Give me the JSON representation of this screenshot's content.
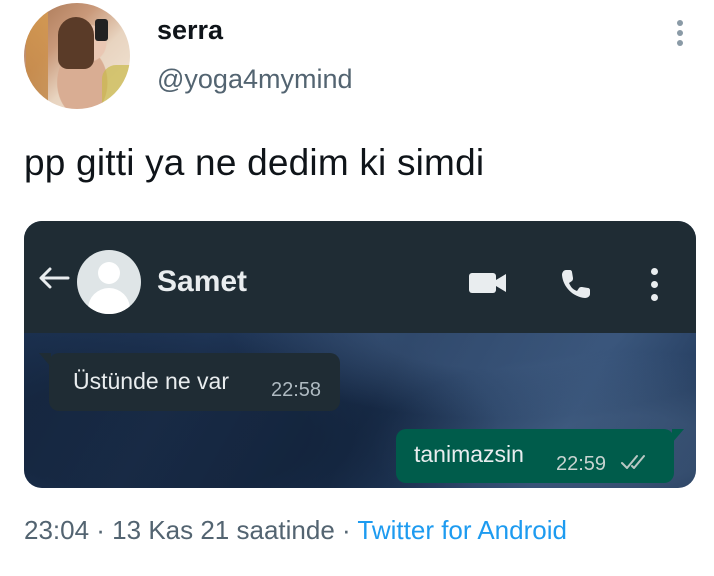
{
  "author": {
    "display_name": "serra",
    "handle": "@yoga4mymind"
  },
  "tweet": {
    "text": "pp gitti ya ne dedim ki simdi"
  },
  "screenshot": {
    "contact_name": "Samet",
    "header_icons": [
      "back-arrow-icon",
      "video-call-icon",
      "phone-icon",
      "more-vertical-icon"
    ],
    "messages": [
      {
        "direction": "incoming",
        "text": "Üstünde ne var",
        "time": "22:58"
      },
      {
        "direction": "outgoing",
        "text": "tanimazsin",
        "time": "22:59",
        "status_icon": "double-check-icon"
      }
    ],
    "colors": {
      "header": "#1f2c34",
      "incoming_bubble": "#1f2c34",
      "outgoing_bubble": "#005c4b"
    }
  },
  "meta": {
    "timestamp": "23:04 · 13 Kas 21 saatinde",
    "separator": " · ",
    "source": "Twitter for Android"
  },
  "colors": {
    "link": "#1d9bf0",
    "secondary_text": "#536471"
  }
}
